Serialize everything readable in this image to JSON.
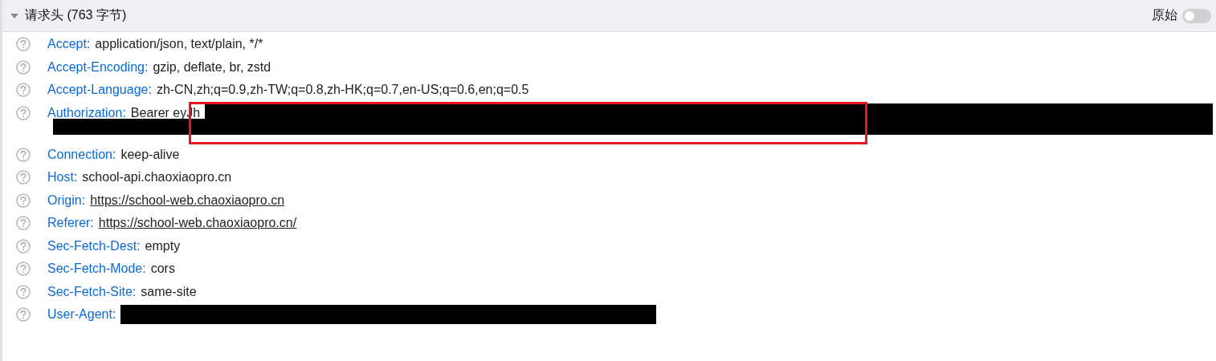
{
  "section": {
    "title": "请求头 (763 字节)",
    "expanded": true,
    "raw_toggle": {
      "label": "原始",
      "on": false
    }
  },
  "headers": [
    {
      "name": "Accept:",
      "value": "application/json, text/plain, */*",
      "link": false,
      "redacted": false,
      "highlighted": false
    },
    {
      "name": "Accept-Encoding:",
      "value": "gzip, deflate, br, zstd",
      "link": false,
      "redacted": false,
      "highlighted": false
    },
    {
      "name": "Accept-Language:",
      "value": "zh-CN,zh;q=0.9,zh-TW;q=0.8,zh-HK;q=0.7,en-US;q=0.6,en;q=0.5",
      "link": false,
      "redacted": false,
      "highlighted": false
    },
    {
      "name": "Authorization:",
      "value": "Bearer eyJh",
      "link": false,
      "redacted": true,
      "highlighted": true
    },
    {
      "name": "Connection:",
      "value": "keep-alive",
      "link": false,
      "redacted": false,
      "highlighted": false
    },
    {
      "name": "Host:",
      "value": "school-api.chaoxiaopro.cn",
      "link": false,
      "redacted": false,
      "highlighted": false
    },
    {
      "name": "Origin:",
      "value": "https://school-web.chaoxiaopro.cn",
      "link": true,
      "redacted": false,
      "highlighted": false
    },
    {
      "name": "Referer:",
      "value": "https://school-web.chaoxiaopro.cn/",
      "link": true,
      "redacted": false,
      "highlighted": false
    },
    {
      "name": "Sec-Fetch-Dest:",
      "value": "empty",
      "link": false,
      "redacted": false,
      "highlighted": false
    },
    {
      "name": "Sec-Fetch-Mode:",
      "value": "cors",
      "link": false,
      "redacted": false,
      "highlighted": false
    },
    {
      "name": "Sec-Fetch-Site:",
      "value": "same-site",
      "link": false,
      "redacted": false,
      "highlighted": false
    },
    {
      "name": "User-Agent:",
      "redacted": true,
      "highlighted": false
    }
  ]
}
